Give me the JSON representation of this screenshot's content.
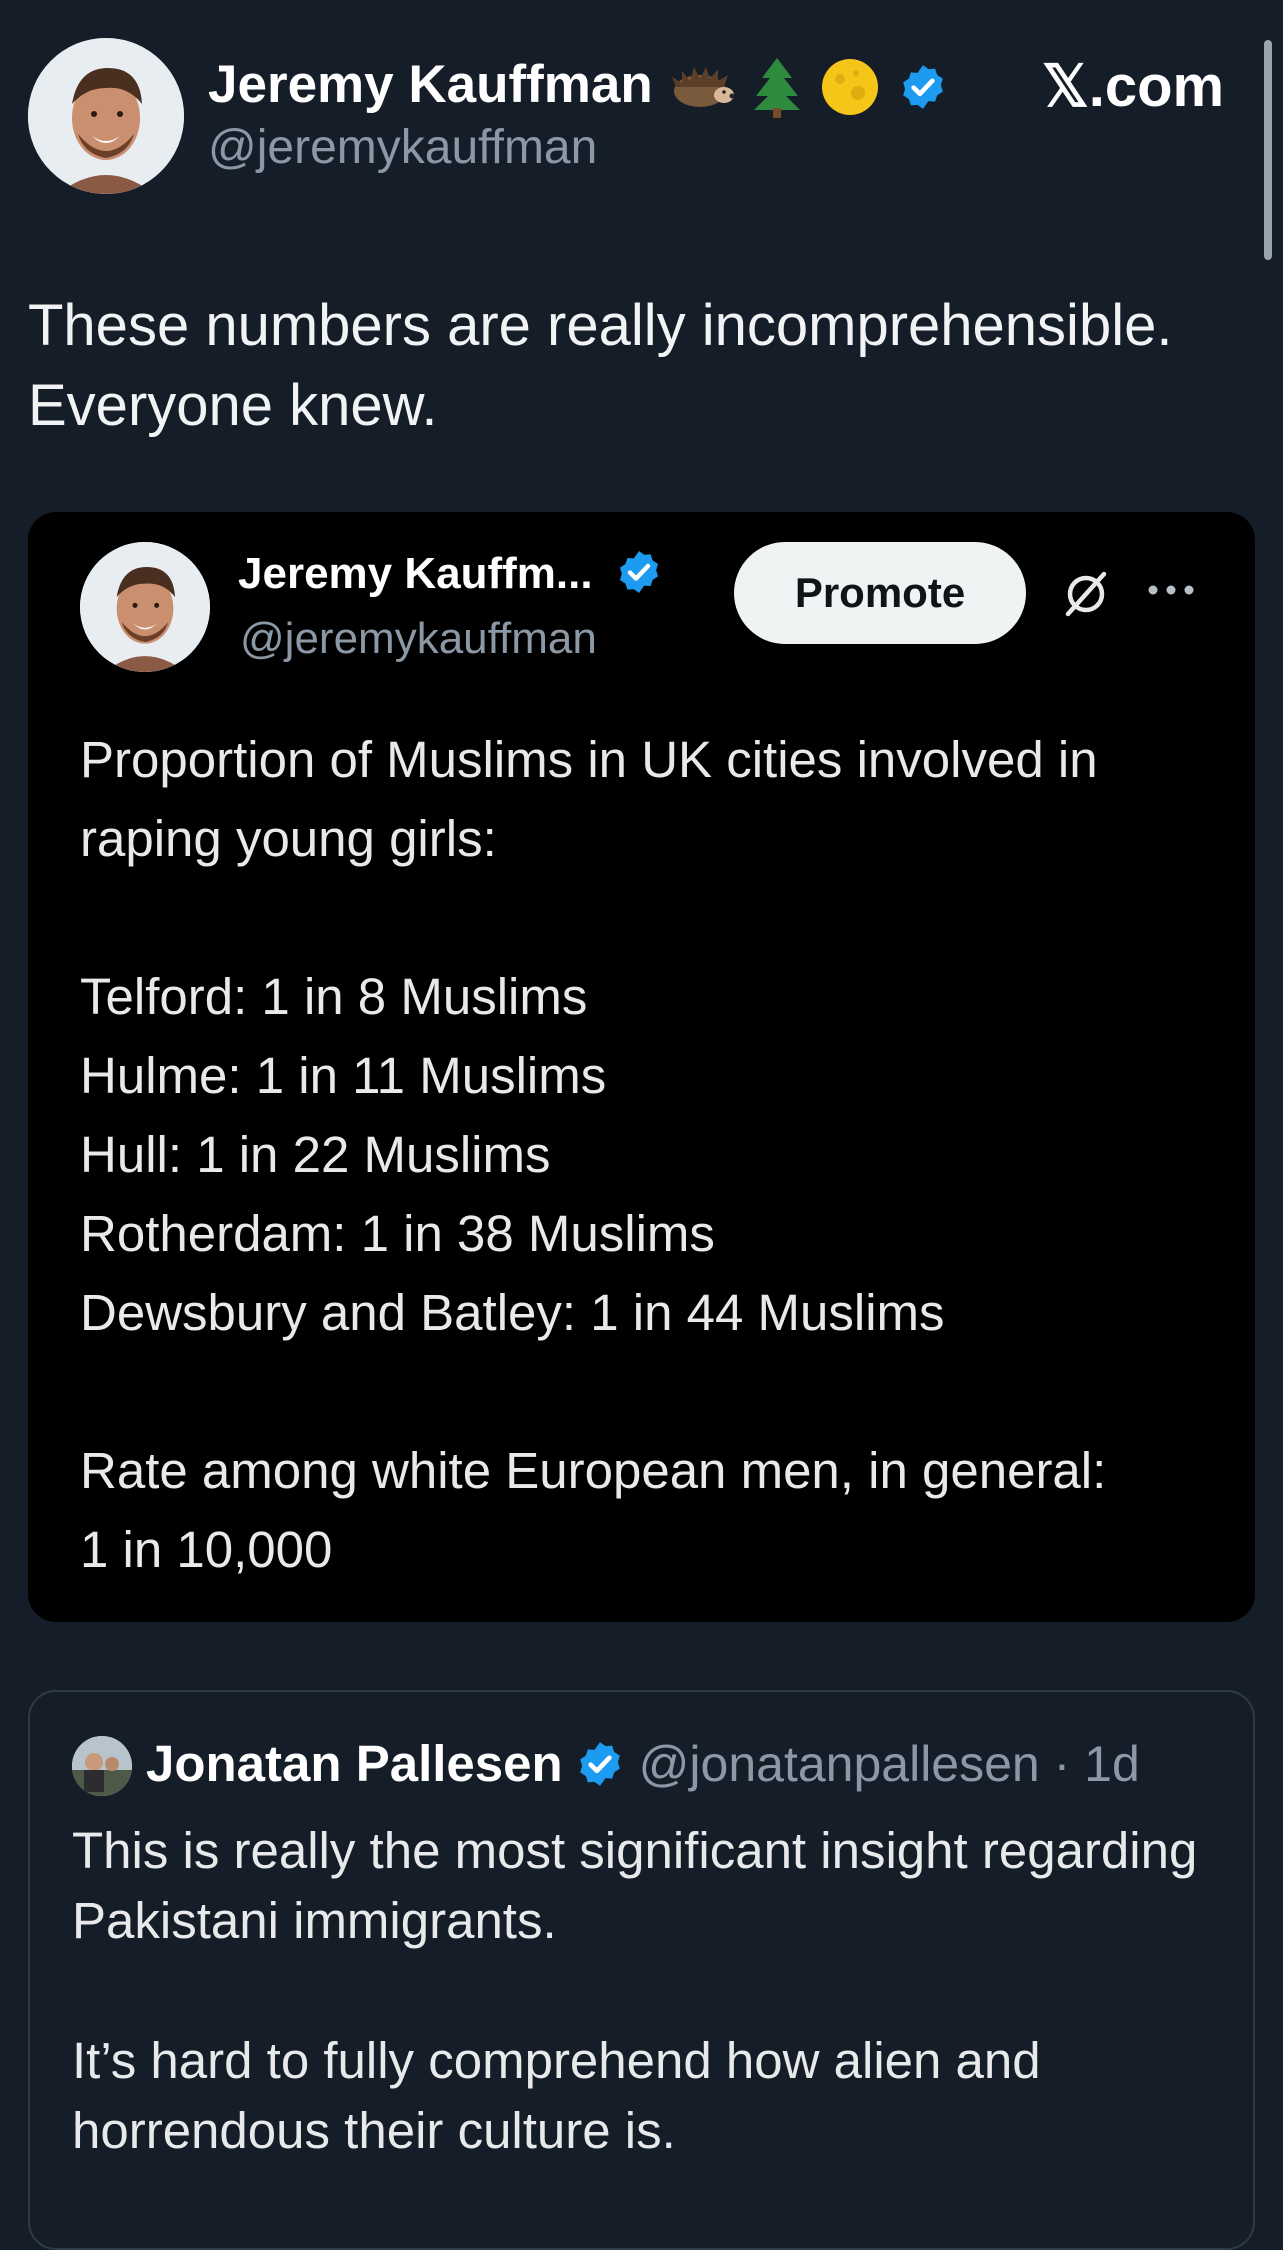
{
  "header": {
    "display_name": "Jeremy Kauffman",
    "handle": "@jeremykauffman",
    "name_emojis": [
      "hedgehog-emoji",
      "tree-emoji",
      "moon-emoji",
      "verified-badge-icon"
    ],
    "site_label": "𝕏.com"
  },
  "post": {
    "text": "These numbers are really incomprehensible. Everyone knew."
  },
  "quoted_post": {
    "display_name": "Jeremy Kauffm...",
    "handle": "@jeremykauffman",
    "promote_label": "Promote",
    "text": "Proportion of Muslims in UK cities involved in raping young girls:\n\nTelford: 1 in 8 Muslims\nHulme: 1 in 11 Muslims\nHull: 1 in 22 Muslims\nRotherdam: 1 in 38 Muslims\nDewsbury and Batley: 1 in 44 Muslims\n\nRate among white European men, in general:\n1 in 10,000"
  },
  "nested_quote": {
    "display_name": "Jonatan Pallesen",
    "handle_time": "@jonatanpallesen · 1d",
    "text": "This is really the most significant insight regarding Pakistani immigrants.\n\nIt’s hard to fully comprehend how alien and horrendous their culture is."
  },
  "colors": {
    "background": "#151d28",
    "quote_background": "#000000",
    "verified_blue": "#1d9bf0",
    "secondary_text": "#8b98a5"
  }
}
